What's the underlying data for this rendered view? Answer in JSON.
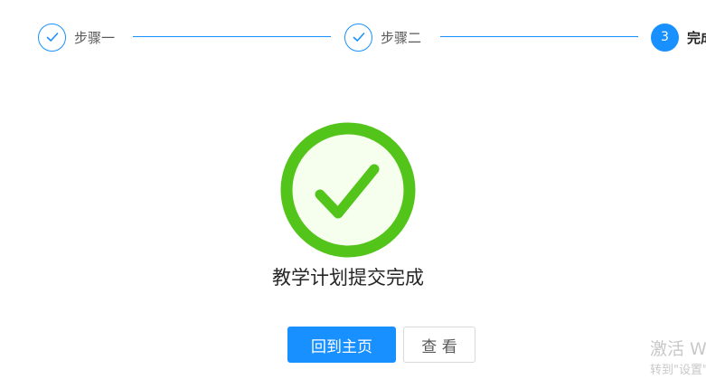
{
  "steps": [
    {
      "title": "步骤一",
      "status": "finished",
      "icon": "check-icon"
    },
    {
      "title": "步骤二",
      "status": "finished",
      "icon": "check-icon"
    },
    {
      "title": "完成",
      "status": "current",
      "number": "3"
    }
  ],
  "result": {
    "icon": "success-check-icon",
    "title": "教学计划提交完成"
  },
  "actions": {
    "home_label": "回到主页",
    "view_label": "查 看"
  },
  "watermark": {
    "line1": "激活 Windows",
    "line2": "转到\"设置\"以激活 Windows。"
  },
  "colors": {
    "primary": "#1890ff",
    "success": "#52c41a",
    "success_bg": "#f6ffed"
  }
}
